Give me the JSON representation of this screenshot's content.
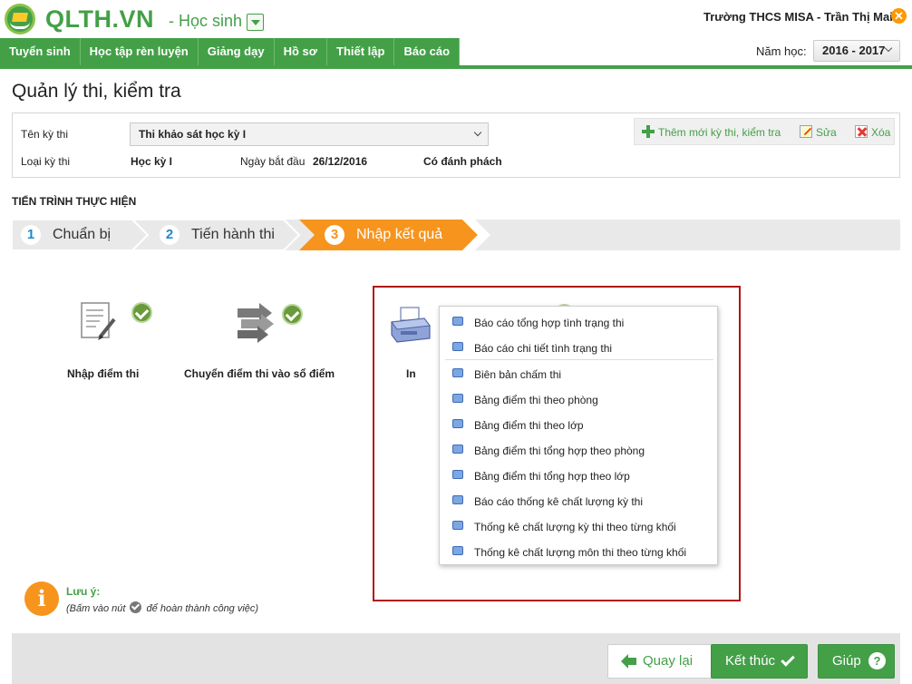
{
  "app": {
    "logo": "QLTH.VN",
    "module": "- Học sinh",
    "user": "Trường THCS MISA - Trần Thị Mai"
  },
  "nav": {
    "tabs": [
      "Tuyển sinh",
      "Học tập rèn luyện",
      "Giảng dạy",
      "Hồ sơ",
      "Thiết lập",
      "Báo cáo"
    ],
    "year_label": "Năm học:",
    "year_value": "2016 - 2017"
  },
  "page": {
    "title": "Quản lý thi, kiểm tra"
  },
  "info": {
    "exam_name_label": "Tên kỳ thi",
    "exam_name_value": "Thi khảo sát học kỳ I",
    "exam_type_label": "Loại kỳ thi",
    "exam_type_value": "Học kỳ I",
    "start_date_label": "Ngày bắt đầu",
    "start_date_value": "26/12/2016",
    "anonymous": "Có đánh phách"
  },
  "actions": {
    "add": "Thêm mới kỳ thi, kiểm tra",
    "edit": "Sửa",
    "delete": "Xóa"
  },
  "progress": {
    "title": "TIẾN TRÌNH THỰC HIỆN",
    "steps": [
      {
        "num": "1",
        "label": "Chuẩn bị"
      },
      {
        "num": "2",
        "label": "Tiến hành thi"
      },
      {
        "num": "3",
        "label": "Nhập kết quả"
      }
    ],
    "active_step": 3
  },
  "tasks": {
    "enter_scores": "Nhập điểm thi",
    "transfer_scores": "Chuyển điểm thi vào sổ điểm",
    "print": "In"
  },
  "report_menu": [
    "Báo cáo tổng hợp tình trạng thi",
    "Báo cáo chi tiết tình trạng thi",
    "Biên bản chấm thi",
    "Bảng điểm thi theo phòng",
    "Bảng điểm thi theo lớp",
    "Bảng điểm thi tổng hợp theo phòng",
    "Bảng điểm thi tổng hợp theo lớp",
    "Báo cáo thống kê chất lượng kỳ thi",
    "Thống kê chất lượng kỳ thi theo từng khối",
    "Thống kê chất lượng môn thi theo từng khối"
  ],
  "note": {
    "title": "Lưu ý:",
    "text_before": "(Bấm vào nút",
    "text_after": "để hoàn thành công việc)"
  },
  "footer": {
    "back": "Quay lại",
    "finish": "Kết thúc",
    "help": "Giúp"
  },
  "colors": {
    "primary_green": "#43a047",
    "step_active_orange": "#f7941d",
    "highlight_red": "#b01515"
  }
}
